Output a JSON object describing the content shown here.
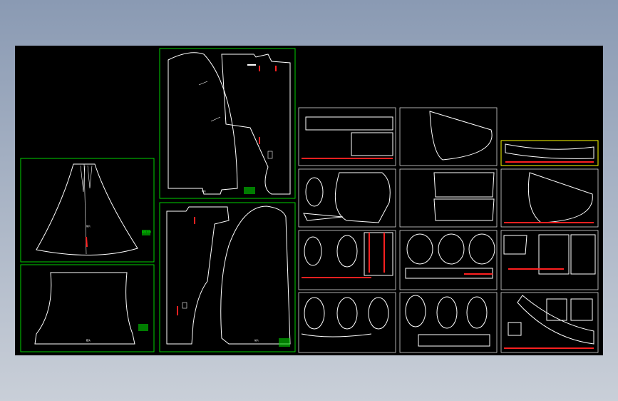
{
  "colors": {
    "background": "#000000",
    "frame_gradient_top": "#8a9ab3",
    "frame_gradient_bottom": "#c9cfd8",
    "pattern_stroke": "#ffffff",
    "sheet_border_green": "#00d000",
    "sheet_border_white": "#d8d8d8",
    "sheet_border_yellow": "#ffff00",
    "marker_red": "#ff2020"
  },
  "piece_labels": {
    "skirt": "前片",
    "band": "腰头",
    "front_upper": "前片",
    "front_lower": "后片",
    "back_upper": "后片",
    "back_lower": "前片"
  },
  "title_blocks": {
    "green_1": "版型 比例",
    "green_2": "版型 比例",
    "green_3": "版型 比例",
    "green_4": "版型 比例"
  }
}
